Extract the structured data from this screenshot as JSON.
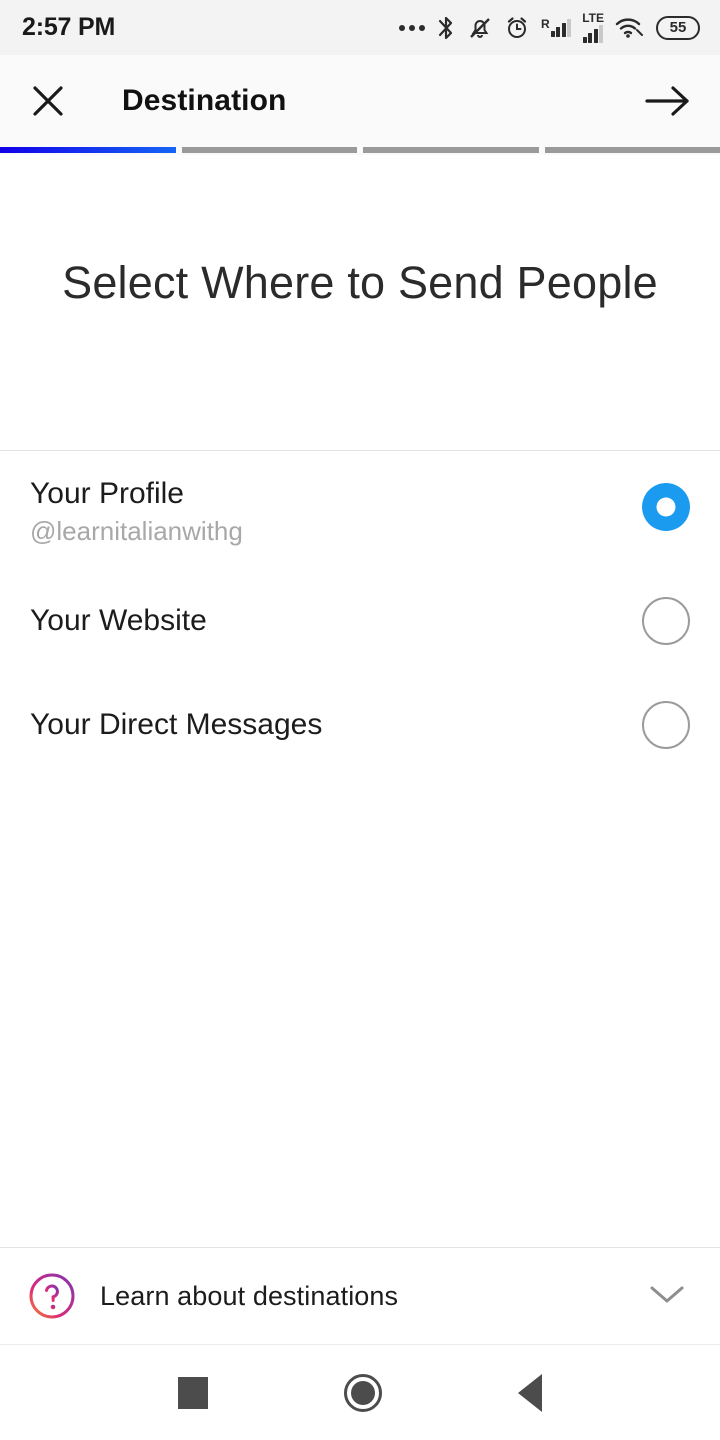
{
  "status_bar": {
    "time": "2:57 PM",
    "icons": [
      "more-dots-icon",
      "bluetooth-icon",
      "notifications-muted-icon",
      "alarm-icon",
      "cellular-signal-icon",
      "lte-signal-icon",
      "wifi-icon",
      "battery-icon"
    ],
    "signal_label_1": "R",
    "signal_label_2": "LTE",
    "battery_level": "55"
  },
  "header": {
    "title": "Destination",
    "close_icon": "close-icon",
    "next_icon": "arrow-right-icon"
  },
  "progress": {
    "total_steps": 4,
    "current_step": 1,
    "active_color": "#1565f5",
    "inactive_color": "#9a9a9a"
  },
  "main": {
    "page_title": "Select Where to Send People",
    "options": [
      {
        "label": "Your Profile",
        "sublabel": "@learnitalianwithg",
        "selected": true
      },
      {
        "label": "Your Website",
        "sublabel": "",
        "selected": false
      },
      {
        "label": "Your Direct Messages",
        "sublabel": "",
        "selected": false
      }
    ],
    "selected_color": "#1a9bf0"
  },
  "footer": {
    "learn_label": "Learn about destinations",
    "help_icon": "question-mark-circle-icon",
    "expand_icon": "chevron-down-icon",
    "gradient_from": "#f05a28",
    "gradient_to": "#8a2be2"
  },
  "navbar": {
    "recents_icon": "square-recents-icon",
    "home_icon": "circle-home-icon",
    "back_icon": "triangle-back-icon"
  }
}
